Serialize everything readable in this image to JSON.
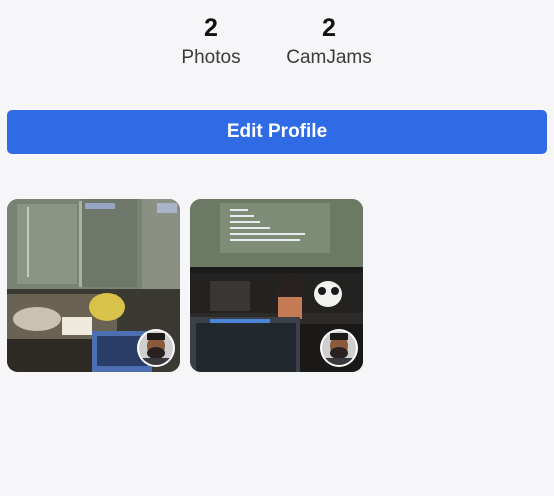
{
  "stats": {
    "photos": {
      "count": "2",
      "label": "Photos"
    },
    "camjams": {
      "count": "2",
      "label": "CamJams"
    }
  },
  "edit_profile": {
    "label": "Edit Profile"
  },
  "accent_color": "#2f6be5",
  "gallery": {
    "items": [
      {
        "icon": "photo-thumbnail-blurred-desk",
        "avatar": "user-avatar"
      },
      {
        "icon": "photo-thumbnail-figurines-laptop",
        "avatar": "user-avatar"
      }
    ]
  }
}
